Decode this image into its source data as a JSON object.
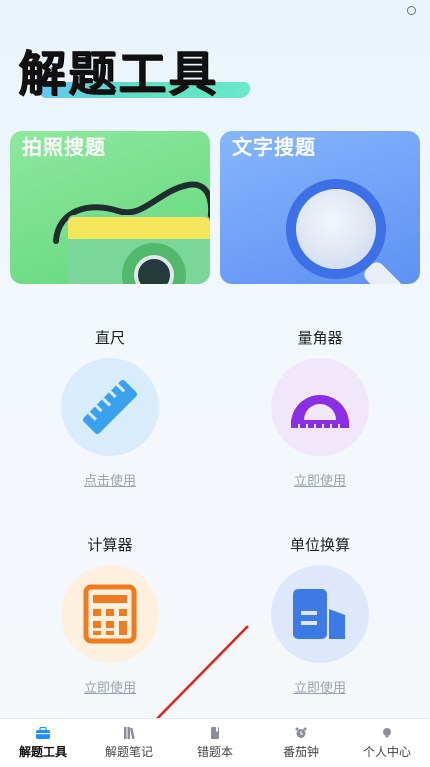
{
  "page": {
    "title": "解题工具"
  },
  "cards": [
    {
      "label": "拍照搜题"
    },
    {
      "label": "文字搜题"
    }
  ],
  "tools": [
    {
      "name": "直尺",
      "action": "点击使用",
      "bg": "#d9ecfb",
      "accent": "#3aa1ee"
    },
    {
      "name": "量角器",
      "action": "立即使用",
      "bg": "#f1e7fb",
      "accent": "#8b2ee6"
    },
    {
      "name": "计算器",
      "action": "立即使用",
      "bg": "#fdf0de",
      "accent": "#f07b1f"
    },
    {
      "name": "单位换算",
      "action": "立即使用",
      "bg": "#dfe8fb",
      "accent": "#3e7ae6"
    }
  ],
  "nav": [
    {
      "label": "解题工具",
      "icon": "toolbox-icon"
    },
    {
      "label": "解题笔记",
      "icon": "books-icon"
    },
    {
      "label": "错题本",
      "icon": "notebook-icon"
    },
    {
      "label": "番茄钟",
      "icon": "alarm-clock-icon"
    },
    {
      "label": "个人中心",
      "icon": "person-icon"
    }
  ],
  "colors": {
    "nav_active": "#1e90ff",
    "annotation_arrow": "#e0241b"
  }
}
